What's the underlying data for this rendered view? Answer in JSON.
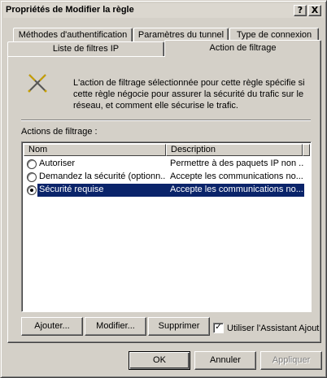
{
  "window": {
    "title": "Propriétés de Modifier la règle",
    "help_label": "?",
    "close_label": "X"
  },
  "tabs": {
    "row1": [
      "Méthodes d'authentification",
      "Paramètres du tunnel",
      "Type de connexion"
    ],
    "row2": [
      "Liste de filtres IP",
      "Action de filtrage"
    ],
    "active": "Action de filtrage"
  },
  "panel": {
    "icon": "filter-action-icon",
    "intro": "L'action de filtrage sélectionnée pour cette règle spécifie si cette règle négocie pour assurer la sécurité du trafic sur le réseau, et comment elle sécurise le trafic.",
    "group_label": "Actions de filtrage :",
    "columns": [
      "Nom",
      "Description"
    ],
    "rows": [
      {
        "name": "Autoriser",
        "description": "Permettre à des paquets IP non ...",
        "checked": false,
        "selected": false
      },
      {
        "name": "Demandez la sécurité (optionn...",
        "description": "Accepte les communications no...",
        "checked": false,
        "selected": false
      },
      {
        "name": "Sécurité requise",
        "description": "Accepte les communications no...",
        "checked": true,
        "selected": true
      }
    ],
    "buttons": {
      "add": "Ajouter...",
      "edit": "Modifier...",
      "delete": "Supprimer"
    },
    "wizard_checkbox": {
      "label": "Utiliser l'Assistant Ajout",
      "checked": true,
      "mark": "✓"
    }
  },
  "footer": {
    "ok": "OK",
    "cancel": "Annuler",
    "apply": "Appliquer",
    "apply_disabled": true
  },
  "colors": {
    "face": "#d4d0c8",
    "selection": "#0a246a"
  }
}
